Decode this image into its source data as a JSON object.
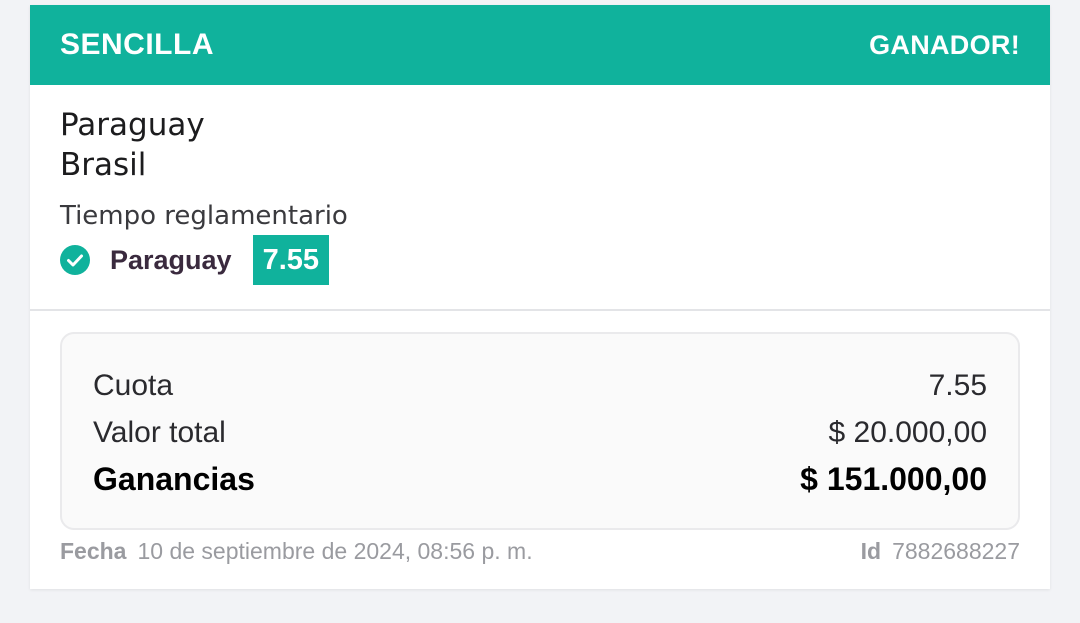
{
  "header": {
    "bet_type": "SENCILLA",
    "result": "GANADOR!"
  },
  "event": {
    "home_team": "Paraguay",
    "away_team": "Brasil",
    "market": "Tiempo reglamentario",
    "selection": "Paraguay",
    "odds": "7.55",
    "status_icon": "check-circle-icon"
  },
  "summary": {
    "odds_label": "Cuota",
    "odds_value": "7.55",
    "stake_label": "Valor total",
    "stake_value": "$ 20.000,00",
    "winnings_label": "Ganancias",
    "winnings_value": "$ 151.000,00"
  },
  "footer": {
    "date_label": "Fecha",
    "date_value": "10 de septiembre de 2024, 08:56 p. m.",
    "id_label": "Id",
    "id_value": "7882688227"
  },
  "colors": {
    "accent": "#10b29c",
    "background": "#f2f3f6"
  }
}
